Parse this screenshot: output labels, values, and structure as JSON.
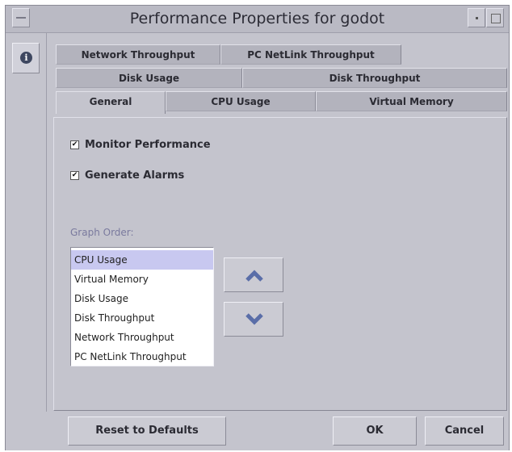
{
  "window": {
    "title": "Performance Properties for godot"
  },
  "tabs": {
    "row1": [
      {
        "id": "network-throughput",
        "label": "Network Throughput"
      },
      {
        "id": "pc-netlink-throughput",
        "label": "PC NetLink Throughput"
      }
    ],
    "row2": [
      {
        "id": "disk-usage",
        "label": "Disk Usage"
      },
      {
        "id": "disk-throughput",
        "label": "Disk Throughput"
      }
    ],
    "row3": [
      {
        "id": "general",
        "label": "General",
        "active": true
      },
      {
        "id": "cpu-usage",
        "label": "CPU Usage"
      },
      {
        "id": "virtual-memory",
        "label": "Virtual Memory"
      }
    ]
  },
  "general": {
    "monitor_performance": {
      "label": "Monitor Performance",
      "checked": true,
      "mark": "✔"
    },
    "generate_alarms": {
      "label": "Generate Alarms",
      "checked": true,
      "mark": "✔"
    },
    "graph_order_label": "Graph Order:",
    "graph_order": [
      {
        "label": "CPU Usage",
        "selected": true
      },
      {
        "label": "Virtual Memory"
      },
      {
        "label": "Disk Usage"
      },
      {
        "label": "Disk Throughput"
      },
      {
        "label": "Network Throughput"
      },
      {
        "label": "PC NetLink Throughput"
      }
    ]
  },
  "icons": {
    "move_up": "chevron-up-icon",
    "move_down": "chevron-down-icon",
    "info": "info-icon",
    "info_glyph": "i"
  },
  "buttons": {
    "reset": "Reset to Defaults",
    "ok": "OK",
    "cancel": "Cancel"
  },
  "colors": {
    "accent": "#5a6ea8",
    "selection": "#c8c8f0",
    "label_blue": "#7a7a9e"
  }
}
